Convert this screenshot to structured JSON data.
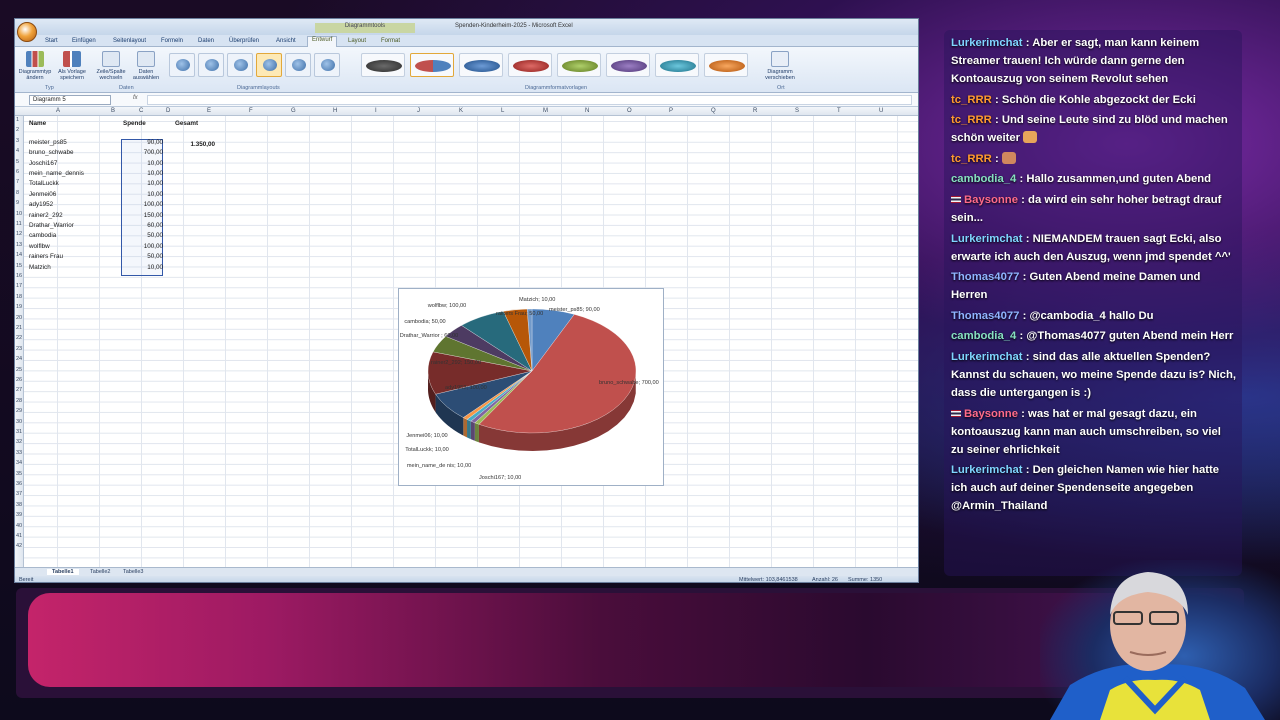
{
  "excel": {
    "window_title": "Spenden-Kinderheim-2025 - Microsoft Excel",
    "context_group": "Diagrammtools",
    "tabs": [
      "Start",
      "Einfügen",
      "Seitenlayout",
      "Formeln",
      "Daten",
      "Überprüfen",
      "Ansicht",
      "Entwurf",
      "Layout",
      "Format"
    ],
    "ribbon": {
      "btn_change_type": "Diagrammtyp ändern",
      "btn_save_template": "Als Vorlage speichern",
      "btn_switch": "Zeile/Spalte wechseln",
      "btn_select_data": "Daten auswählen",
      "btn_move_chart": "Diagramm verschieben",
      "group_type": "Typ",
      "group_data": "Daten",
      "group_layouts": "Diagrammlayouts",
      "group_styles": "Diagrammformatvorlagen",
      "group_location": "Ort"
    },
    "name_box": "Diagramm 5",
    "fx_label": "fx",
    "columns": [
      "A",
      "B",
      "C",
      "D",
      "E",
      "F",
      "G",
      "H",
      "I",
      "J",
      "K",
      "L",
      "M",
      "N",
      "O",
      "P",
      "Q",
      "R",
      "S",
      "T",
      "U"
    ],
    "rows": [
      "1",
      "2",
      "3",
      "4",
      "5",
      "6",
      "7",
      "8",
      "9",
      "10",
      "11",
      "12",
      "13",
      "14",
      "15",
      "16",
      "17",
      "18",
      "19",
      "20",
      "21",
      "22",
      "23",
      "24",
      "25",
      "26",
      "27",
      "28",
      "29",
      "30",
      "31",
      "32",
      "33",
      "34",
      "35",
      "36",
      "37",
      "38",
      "39",
      "40",
      "41",
      "42"
    ],
    "headers": {
      "name": "Name",
      "spende": "Spende",
      "gesamt": "Gesamt"
    },
    "total": "1.350,00",
    "donations": [
      {
        "name": "meister_ps85",
        "amount": "90,00"
      },
      {
        "name": "bruno_schwabe",
        "amount": "700,00"
      },
      {
        "name": "Joschi167",
        "amount": "10,00"
      },
      {
        "name": "mein_name_dennis",
        "amount": "10,00"
      },
      {
        "name": "TotalLuckk",
        "amount": "10,00"
      },
      {
        "name": "Jenmei06",
        "amount": "10,00"
      },
      {
        "name": "ady1952",
        "amount": "100,00"
      },
      {
        "name": "rainer2_292",
        "amount": "150,00"
      },
      {
        "name": "Drathar_Warrior",
        "amount": "60,00"
      },
      {
        "name": "cambodia",
        "amount": "50,00"
      },
      {
        "name": "wolflbw",
        "amount": "100,00"
      },
      {
        "name": "rainers Frau",
        "amount": "50,00"
      },
      {
        "name": "Matzich",
        "amount": "10,00"
      }
    ],
    "sheets": [
      "Tabelle1",
      "Tabelle2",
      "Tabelle3"
    ],
    "status": {
      "ready": "Bereit",
      "average": "Mittelwert: 103,8461538",
      "count": "Anzahl: 26",
      "sum": "Summe: 1350"
    }
  },
  "chart_data": {
    "type": "pie",
    "categories": [
      "meister_ps85",
      "bruno_schwabe",
      "Joschi167",
      "mein_name_dennis",
      "TotalLuckk",
      "Jenmei06",
      "ady1952",
      "rainer2_292",
      "Drathar_Warrior",
      "cambodia",
      "wolflbw",
      "rainers Frau",
      "Matzich"
    ],
    "values": [
      90,
      700,
      10,
      10,
      10,
      10,
      100,
      150,
      60,
      50,
      100,
      50,
      10
    ],
    "colors": [
      "#4f81bd",
      "#c0504d",
      "#9bbb59",
      "#8064a2",
      "#4bacc6",
      "#f79646",
      "#2c4d75",
      "#772c2a",
      "#5f7530",
      "#4d3b62",
      "#276a7c",
      "#b65708",
      "#729aca"
    ],
    "labels": [
      "meister_ps85; 90,00",
      "bruno_schwabe; 700,00",
      "Joschi167; 10,00",
      "mein_name_de nis; 10,00",
      "TotalLuckk; 10,00",
      "Jenmei06; 10,00",
      "ady1952; 100,00",
      "rainer2_292; 150,00",
      "Drathar_Warrior ; 60,00",
      "cambodia; 50,00",
      "wolflbw; 100,00",
      "rainers Frau; 50,00",
      "Matzich; 10,00"
    ]
  },
  "chat": [
    {
      "user": "Lurkerimchat",
      "color": "#7fd6ff",
      "flag": false,
      "text": " : Aber er sagt, man kann keinem Streamer trauen! Ich würde dann gerne den Kontoauszug von seinem Revolut sehen"
    },
    {
      "user": "tc_RRR",
      "color": "#ff9a2e",
      "flag": false,
      "text": " : Schön die Kohle abgezockt der Ecki"
    },
    {
      "user": "tc_RRR",
      "color": "#ff9a2e",
      "flag": false,
      "text": " : Und seine Leute sind zu blöd und machen schön weiter",
      "emote": "#e7a45a"
    },
    {
      "user": "tc_RRR",
      "color": "#ff9a2e",
      "flag": false,
      "text": " :",
      "emote": "#d0885e"
    },
    {
      "user": "cambodia_4",
      "color": "#86e0c0",
      "flag": false,
      "text": " : Hallo zusammen,und guten Abend"
    },
    {
      "user": "Baysonne",
      "color": "#ff6b8a",
      "flag": true,
      "text": " : da wird ein sehr hoher betragt drauf sein..."
    },
    {
      "user": "Lurkerimchat",
      "color": "#7fd6ff",
      "flag": false,
      "text": " : NIEMANDEM trauen sagt Ecki, also erwarte ich auch den Auszug, wenn jmd spendet ^^'"
    },
    {
      "user": "Thomas4077",
      "color": "#8fb4ff",
      "flag": false,
      "text": " : Guten Abend meine Damen und Herren"
    },
    {
      "user": "Thomas4077",
      "color": "#8fb4ff",
      "flag": false,
      "text": " : @cambodia_4 hallo Du"
    },
    {
      "user": "cambodia_4",
      "color": "#86e0c0",
      "flag": false,
      "text": " : @Thomas4077 guten Abend mein Herr"
    },
    {
      "user": "Lurkerimchat",
      "color": "#7fd6ff",
      "flag": false,
      "text": " : sind das alle aktuellen Spenden? Kannst du schauen, wo meine Spende dazu is? Nich, dass die untergangen is :)"
    },
    {
      "user": "Baysonne",
      "color": "#ff6b8a",
      "flag": true,
      "text": " : was hat er mal gesagt dazu, ein kontoauszug kann man auch umschreiben, so viel zu seiner ehrlichkeit"
    },
    {
      "user": "Lurkerimchat",
      "color": "#7fd6ff",
      "flag": false,
      "text": " : Den gleichen Namen wie hier hatte ich auch auf deiner Spendenseite angegeben @Armin_Thailand"
    }
  ]
}
